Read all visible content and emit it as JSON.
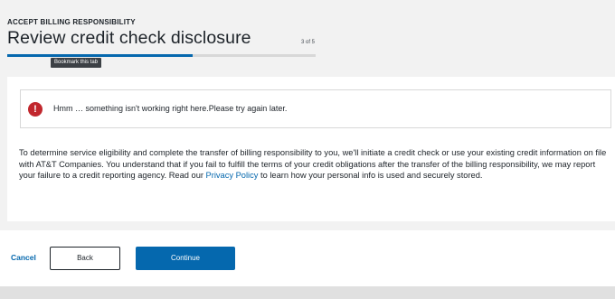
{
  "header": {
    "eyebrow": "ACCEPT BILLING RESPONSIBILITY",
    "title": "Review credit check disclosure",
    "step_count": "3 of 5",
    "progress_fraction": 0.6,
    "tooltip": "Bookmark this tab"
  },
  "alert": {
    "icon": "error-icon",
    "icon_glyph": "!",
    "message": "Hmm … something isn't working right here.Please try again later."
  },
  "disclosure": {
    "text_before_link": "To determine service eligibility and complete the transfer of billing responsibility to you, we'll initiate a credit check or use your existing credit information on file with AT&T Companies. You understand that if you fail to fulfill the terms of your credit obligations after the transfer of the billing responsibility, we may report your failure to a credit reporting agency. Read our ",
    "link_text": "Privacy Policy",
    "text_after_link": " to learn how your personal info is used and securely stored."
  },
  "footer": {
    "cancel_label": "Cancel",
    "back_label": "Back",
    "continue_label": "Continue"
  },
  "colors": {
    "accent": "#0568ae",
    "error": "#c1272d",
    "text": "#1d2329",
    "page_background": "#f2f2f2"
  }
}
